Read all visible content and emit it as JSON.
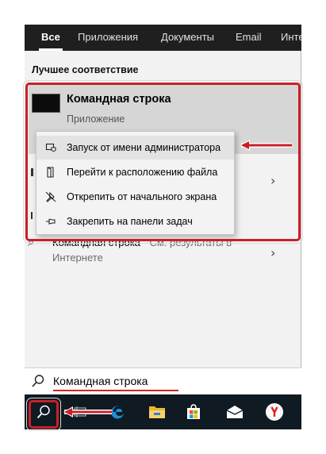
{
  "tabs": [
    {
      "label": "Все",
      "active": true
    },
    {
      "label": "Приложения"
    },
    {
      "label": "Документы"
    },
    {
      "label": "Email"
    },
    {
      "label": "Инте"
    }
  ],
  "best_match": {
    "heading": "Лучшее соответствие",
    "app_name": "Командная строка",
    "app_type": "Приложение"
  },
  "context_menu": {
    "items": [
      {
        "label": "Запуск от имени администратора",
        "icon": "shield-icon",
        "highlighted": true
      },
      {
        "label": "Перейти к расположению файла",
        "icon": "folder-icon"
      },
      {
        "label": "Открепить от начального экрана",
        "icon": "unpin-icon"
      },
      {
        "label": "Закрепить на панели задач",
        "icon": "pin-icon"
      }
    ]
  },
  "web_result": {
    "query": "Командная строка",
    "hint": " - См. результаты в Интернете"
  },
  "search": {
    "value": "Командная строка"
  },
  "taskbar": {
    "items": [
      "search-icon",
      "task-view-icon",
      "edge-icon",
      "file-explorer-icon",
      "store-icon",
      "mail-icon",
      "yandex-browser-icon"
    ]
  },
  "colors": {
    "annotation_red": "#c8202a",
    "tabbar_bg": "#1f1f1f",
    "taskbar_bg": "#0f1a22",
    "best_match_bg": "#d6d6d6"
  }
}
